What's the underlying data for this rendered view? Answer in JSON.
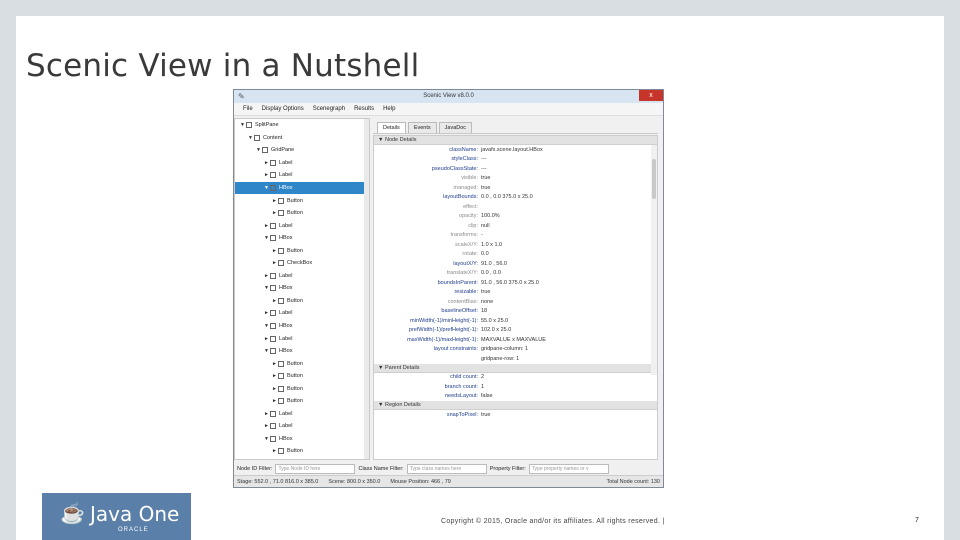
{
  "slide": {
    "title": "Scenic View in a Nutshell",
    "copyright": "Copyright © 2015, Oracle and/or its affiliates. All rights reserved.  |",
    "page_number": "7",
    "logo": {
      "name": "Java One",
      "sub": "ORACLE",
      "icon": "java-cup-icon"
    }
  },
  "window": {
    "title": "Scenic View v8.0.0",
    "close_label": "x",
    "menu": [
      "File",
      "Display Options",
      "Scenegraph",
      "Results",
      "Help"
    ],
    "tree": [
      {
        "depth": 0,
        "arrow": "▼",
        "label": "SplitPane"
      },
      {
        "depth": 1,
        "arrow": "▼",
        "label": "Content"
      },
      {
        "depth": 2,
        "arrow": "▼",
        "label": "GridPane"
      },
      {
        "depth": 3,
        "arrow": "►",
        "label": "Label"
      },
      {
        "depth": 3,
        "arrow": "►",
        "label": "Label"
      },
      {
        "depth": 3,
        "arrow": "▼",
        "label": "HBox",
        "selected": true
      },
      {
        "depth": 4,
        "arrow": "►",
        "label": "Button"
      },
      {
        "depth": 4,
        "arrow": "►",
        "label": "Button"
      },
      {
        "depth": 3,
        "arrow": "►",
        "label": "Label"
      },
      {
        "depth": 3,
        "arrow": "▼",
        "label": "HBox"
      },
      {
        "depth": 4,
        "arrow": "►",
        "label": "Button"
      },
      {
        "depth": 4,
        "arrow": "►",
        "label": "CheckBox"
      },
      {
        "depth": 3,
        "arrow": "►",
        "label": "Label"
      },
      {
        "depth": 3,
        "arrow": "▼",
        "label": "HBox"
      },
      {
        "depth": 4,
        "arrow": "►",
        "label": "Button"
      },
      {
        "depth": 3,
        "arrow": "►",
        "label": "Label"
      },
      {
        "depth": 3,
        "arrow": "▼",
        "label": "HBox"
      },
      {
        "depth": 3,
        "arrow": "►",
        "label": "Label"
      },
      {
        "depth": 3,
        "arrow": "▼",
        "label": "HBox"
      },
      {
        "depth": 4,
        "arrow": "►",
        "label": "Button"
      },
      {
        "depth": 4,
        "arrow": "►",
        "label": "Button"
      },
      {
        "depth": 4,
        "arrow": "►",
        "label": "Button"
      },
      {
        "depth": 4,
        "arrow": "►",
        "label": "Button"
      },
      {
        "depth": 3,
        "arrow": "►",
        "label": "Label"
      },
      {
        "depth": 3,
        "arrow": "►",
        "label": "Label"
      },
      {
        "depth": 3,
        "arrow": "▼",
        "label": "HBox"
      },
      {
        "depth": 4,
        "arrow": "►",
        "label": "Button"
      }
    ],
    "tabs": [
      "Details",
      "Events",
      "JavaDoc"
    ],
    "node_details": {
      "header": "▼ Node Details",
      "rows": [
        {
          "label": "className:",
          "value": "javafx.scene.layout.HBox"
        },
        {
          "label": "styleClass:",
          "value": "---"
        },
        {
          "label": "pseudoClassState:",
          "value": "---"
        },
        {
          "label": "visible:",
          "value": "true",
          "grey": true
        },
        {
          "label": "managed:",
          "value": "true",
          "grey": true
        },
        {
          "label": "layoutBounds:",
          "value": "0.0 , 0.0  375.0 x 25.0"
        },
        {
          "label": "effect:",
          "value": "",
          "grey": true
        },
        {
          "label": "opacity:",
          "value": "100.0%",
          "grey": true
        },
        {
          "label": "clip:",
          "value": "null",
          "grey": true
        },
        {
          "label": "transforms:",
          "value": "-",
          "grey": true
        },
        {
          "label": "scaleX/Y:",
          "value": "1.0 x 1.0",
          "grey": true
        },
        {
          "label": "rotate:",
          "value": "0.0",
          "grey": true
        },
        {
          "label": "layoutX/Y:",
          "value": "91.0 , 56.0"
        },
        {
          "label": "translateX/Y:",
          "value": "0.0 , 0.0",
          "grey": true
        },
        {
          "label": "boundsInParent:",
          "value": "91.0 , 56.0  375.0 x 25.0"
        },
        {
          "label": "resizable:",
          "value": "true"
        },
        {
          "label": "contentBias:",
          "value": "none",
          "grey": true
        },
        {
          "label": "baselineOffset:",
          "value": "18"
        },
        {
          "label": "minWidth(-1)/minHeight(-1):",
          "value": "55.0 x 25.0"
        },
        {
          "label": "prefWidth(-1)/prefHeight(-1):",
          "value": "102.0 x 25.0"
        },
        {
          "label": "maxWidth(-1)/maxHeight(-1):",
          "value": "MAXVALUE x MAXVALUE"
        },
        {
          "label": "layout constraints:",
          "value": "gridpane-column: 1"
        },
        {
          "label": "",
          "value": "gridpane-row: 1"
        }
      ]
    },
    "parent_details": {
      "header": "▼ Parent Details",
      "rows": [
        {
          "label": "child count:",
          "value": "2"
        },
        {
          "label": "branch count:",
          "value": "1"
        },
        {
          "label": "needsLayout:",
          "value": "false"
        }
      ]
    },
    "region_details": {
      "header": "▼ Region Details",
      "rows": [
        {
          "label": "snapToPixel:",
          "value": "true"
        }
      ]
    },
    "filters": {
      "node_id_label": "Node ID Filter:",
      "node_id_placeholder": "Type Node ID here",
      "class_name_label": "Class Name Filter:",
      "class_name_placeholder": "Type class names here",
      "property_label": "Property Filter:",
      "property_placeholder": "Type property names or v"
    },
    "status": {
      "stage": "Stage: 552.0 , 71.0  816.0 x 385.0",
      "scene": "Scene: 800.0 x 350.0",
      "mouse": "Mouse Position: 466 , 79",
      "total": "Total Node count: 130"
    }
  }
}
